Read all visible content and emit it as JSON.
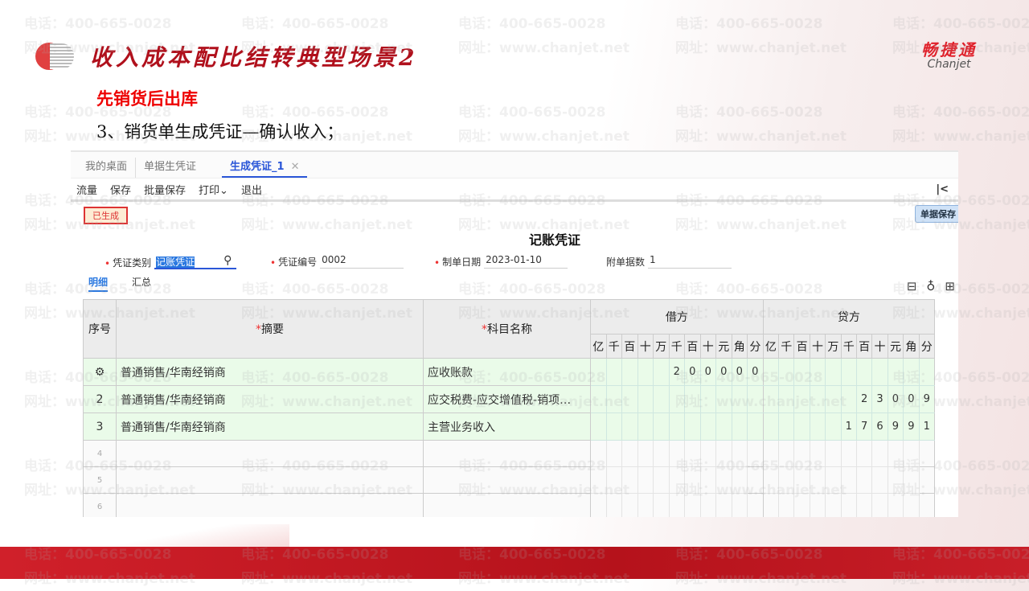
{
  "watermark": {
    "phone": "电话：400-665-0028",
    "site": "网址：www.chanjet.net"
  },
  "slide": {
    "title": "收入成本配比结转典型场景2",
    "subtitle": "先销货后出库",
    "step": "3、销货单生成凭证—确认收入；"
  },
  "brand": {
    "cn": "畅捷通",
    "en": "Chanjet"
  },
  "app": {
    "tabs": [
      {
        "label": "我的桌面"
      },
      {
        "label": "单据生凭证"
      },
      {
        "label": "生成凭证_1",
        "active": true
      }
    ],
    "toolbar": [
      "流量",
      "保存",
      "批量保存",
      "打印⌄",
      "退出"
    ],
    "collapse": "|<",
    "status_badge": "已生成",
    "save_tag": "单据保存",
    "voucher_title": "记账凭证",
    "fields": {
      "type_label": "凭证类别",
      "type_value": "记账凭证",
      "no_label": "凭证编号",
      "no_value": "0002",
      "date_label": "制单日期",
      "date_value": "2023-01-10",
      "attach_label": "附单据数",
      "attach_value": "1"
    },
    "subtabs": [
      "明细",
      "汇总"
    ],
    "table": {
      "headers": {
        "seq": "序号",
        "summary": "摘要",
        "account": "科目名称",
        "debit": "借方",
        "credit": "贷方",
        "required": "*"
      },
      "units": [
        "亿",
        "千",
        "百",
        "十",
        "万",
        "千",
        "百",
        "十",
        "元",
        "角",
        "分"
      ],
      "rows": [
        {
          "seq": "⚙",
          "summary": "普通销售/华南经销商",
          "account": "应收账款",
          "debit": "200000",
          "credit": ""
        },
        {
          "seq": "2",
          "summary": "普通销售/华南经销商",
          "account": "应交税费-应交增值税-销项…",
          "debit": "",
          "credit": "23009"
        },
        {
          "seq": "3",
          "summary": "普通销售/华南经销商",
          "account": "主营业务收入",
          "debit": "",
          "credit": "176991"
        }
      ],
      "empty_rows": [
        "4",
        "5",
        "6"
      ]
    }
  }
}
